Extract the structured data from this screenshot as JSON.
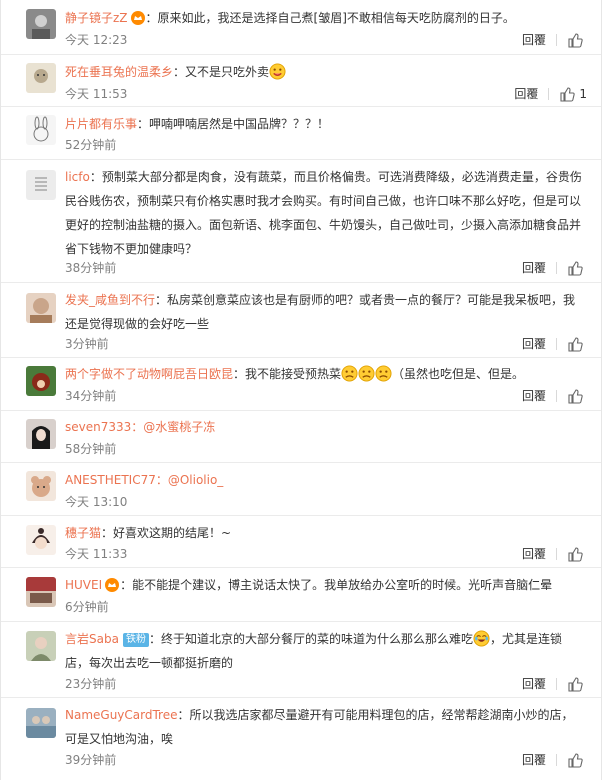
{
  "labels": {
    "reply": "回覆"
  },
  "colors": {
    "name": "#eb7350",
    "time": "#808080",
    "divider": "#ebebeb"
  },
  "comments": [
    {
      "name": "静子镜子zZ",
      "badge": "vip-crown-icon",
      "text": "：原来如此，我还是选择自己煮[皱眉]不敢相信每天吃防腐剂的日子。",
      "time": "今天 12:23",
      "likes": "",
      "avatar_color": "#8a8a8a"
    },
    {
      "name": "死在垂耳兔的温柔乡",
      "text": "：又不是只吃外卖",
      "emoji_after": "smirk-emoji-icon",
      "time": "今天 11:53",
      "likes": "1",
      "avatar_color": "#b8a98e"
    },
    {
      "name": "片片都有乐事",
      "text": "：呷喃呷喃居然是中国品牌？？？！",
      "time": "52分钟前",
      "likes": "",
      "avatar_color": "#f3f3f3"
    },
    {
      "name": "licfo",
      "text": "：预制菜大部分都是肉食，没有蔬菜，而且价格偏贵。可选消费降级，必选消费走量，谷贵伤民谷贱伤农，预制菜只有价格实惠时我才会购买。有时间自己做，也许口味不那么好吃，但是可以更好的控制油盐糖的摄入。面包新语、桃李面包、牛奶馒头，自己做吐司，少摄入高添加糖食品并省下钱物不更加健康吗？",
      "time": "38分钟前",
      "likes": "",
      "avatar_color": "#cfcfcf"
    },
    {
      "name": "发夹_咸鱼到不行",
      "text": "：私房菜创意菜应该也是有厨师的吧？或者贵一点的餐厅？可能是我呆板吧，我还是觉得现做的会好吃一些",
      "time": "3分钟前",
      "likes": "",
      "avatar_color": "#c9a58a"
    },
    {
      "name": "两个字做不了动物啊屁吾日欧昆",
      "text": "：我不能接受预热菜",
      "emoji_after": "sad-emoji-icon",
      "text2": "（虽然也吃但是、但是。",
      "time": "34分钟前",
      "likes": "",
      "avatar_color": "#4a7a3a"
    },
    {
      "name": "seven7333",
      "mention": "：@水蜜桃子冻",
      "time": "58分钟前",
      "likes": "",
      "avatar_color": "#3a3a3a"
    },
    {
      "name": "ANESTHETIC77",
      "mention": "：@Oliolio_",
      "time": "今天 13:10",
      "likes": "",
      "avatar_color": "#d9a98a"
    },
    {
      "name": "穗子猫",
      "text": "：好喜欢这期的结尾！~",
      "time": "今天 11:33",
      "likes": "",
      "avatar_color": "#e8d8d0"
    },
    {
      "name": "HUVEI",
      "badge": "vip-crown-icon",
      "text": "：能不能提个建议，博主说话太快了。我单放给办公室听的时候。光听声音脑仁晕",
      "time": "6分钟前",
      "likes": "",
      "avatar_color": "#a83a3a"
    },
    {
      "name": "言岩Saba",
      "tag": "铁粉",
      "text": "：终于知道北京的大部分餐厅的菜的味道为什么那么那么难吃",
      "emoji_after": "laugh-cry-emoji-icon",
      "text2": "，尤其是连锁店，每次出去吃一顿都挺折磨的",
      "time": "23分钟前",
      "likes": "",
      "avatar_color": "#7d8a6a"
    },
    {
      "name": "NameGuyCardTree",
      "text": "：所以我选店家都尽量避开有可能用料理包的店，经常帮趁湖南小炒的店，可是又怕地沟油，唉",
      "time": "39分钟前",
      "likes": "",
      "avatar_color": "#6b8aa0"
    }
  ]
}
